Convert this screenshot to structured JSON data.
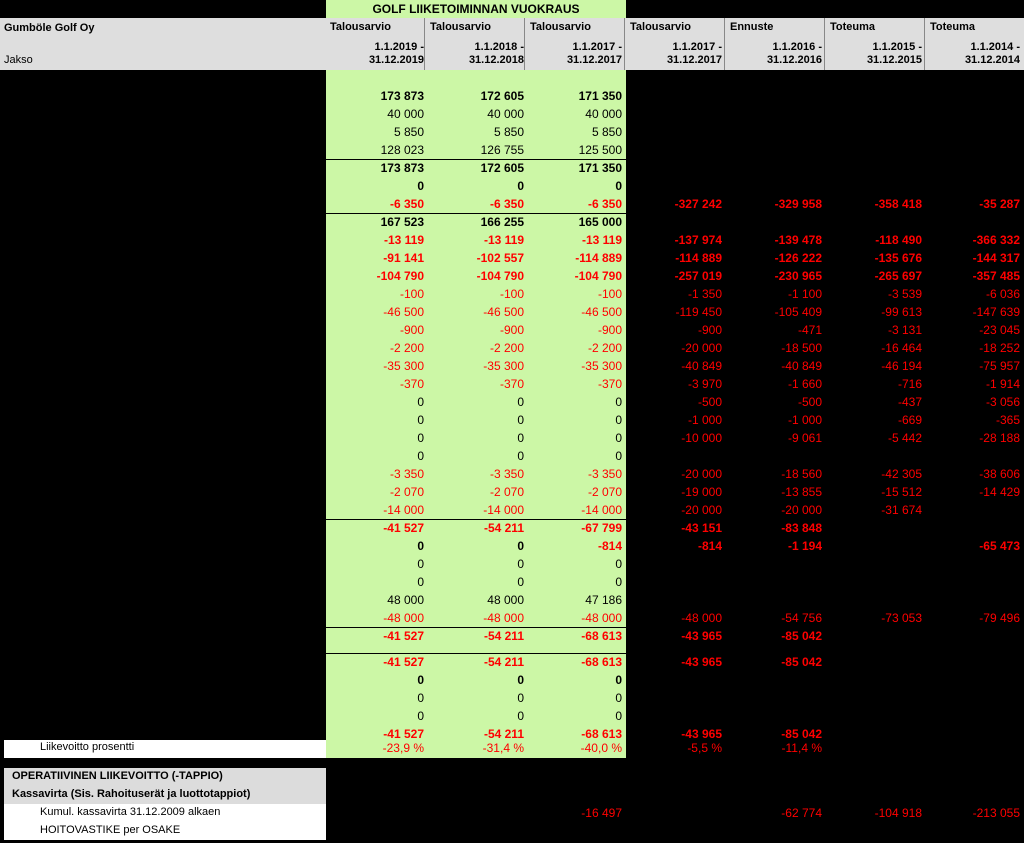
{
  "header": {
    "section_title": "GOLF LIIKETOIMINNAN VUOKRAUS",
    "company": "Gumböle Golf Oy",
    "period_label": "Jakso",
    "columns": [
      {
        "type": "Talousarvio",
        "p1": "1.1.2019 -",
        "p2": "31.12.2019"
      },
      {
        "type": "Talousarvio",
        "p1": "1.1.2018 -",
        "p2": "31.12.2018"
      },
      {
        "type": "Talousarvio",
        "p1": "1.1.2017 -",
        "p2": "31.12.2017"
      },
      {
        "type": "Talousarvio",
        "p1": "1.1.2017 -",
        "p2": "31.12.2017"
      },
      {
        "type": "Ennuste",
        "p1": "1.1.2016 -",
        "p2": "31.12.2016"
      },
      {
        "type": "Toteuma",
        "p1": "1.1.2015 -",
        "p2": "31.12.2015"
      },
      {
        "type": "Toteuma",
        "p1": "1.1.2014 -",
        "p2": "31.12.2014"
      }
    ]
  },
  "rows": [
    {
      "v": [
        "",
        "",
        "",
        "",
        "",
        "",
        ""
      ]
    },
    {
      "v": [
        "173 873",
        "172 605",
        "171 350",
        "",
        "",
        "",
        ""
      ],
      "bold": true
    },
    {
      "v": [
        "40 000",
        "40 000",
        "40 000",
        "",
        "",
        "",
        ""
      ]
    },
    {
      "v": [
        "5 850",
        "5 850",
        "5 850",
        "",
        "",
        "",
        ""
      ]
    },
    {
      "v": [
        "128 023",
        "126 755",
        "125 500",
        "",
        "",
        "",
        ""
      ]
    },
    {
      "v": [
        "173 873",
        "172 605",
        "171 350",
        "",
        "",
        "",
        ""
      ],
      "bold": true,
      "line": true
    },
    {
      "v": [
        "0",
        "0",
        "0",
        "",
        "",
        "",
        ""
      ],
      "bold": true
    },
    {
      "v": [
        "-6 350",
        "-6 350",
        "-6 350",
        "-327 242",
        "-329 958",
        "-358 418",
        "-35 287"
      ],
      "bold": true,
      "red": true
    },
    {
      "v": [
        "167 523",
        "166 255",
        "165 000",
        "",
        "",
        "",
        ""
      ],
      "bold": true,
      "line": true
    },
    {
      "v": [
        "-13 119",
        "-13 119",
        "-13 119",
        "-137 974",
        "-139 478",
        "-118 490",
        "-366 332"
      ],
      "bold": true,
      "red": true
    },
    {
      "v": [
        "-91 141",
        "-102 557",
        "-114 889",
        "-114 889",
        "-126 222",
        "-135 676",
        "-144 317"
      ],
      "bold": true,
      "red": true
    },
    {
      "v": [
        "-104 790",
        "-104 790",
        "-104 790",
        "-257 019",
        "-230 965",
        "-265 697",
        "-357 485"
      ],
      "bold": true,
      "red": true
    },
    {
      "v": [
        "-100",
        "-100",
        "-100",
        "-1 350",
        "-1 100",
        "-3 539",
        "-6 036"
      ],
      "red": true
    },
    {
      "v": [
        "-46 500",
        "-46 500",
        "-46 500",
        "-119 450",
        "-105 409",
        "-99 613",
        "-147 639"
      ],
      "red": true
    },
    {
      "v": [
        "-900",
        "-900",
        "-900",
        "-900",
        "-471",
        "-3 131",
        "-23 045"
      ],
      "red": true
    },
    {
      "v": [
        "-2 200",
        "-2 200",
        "-2 200",
        "-20 000",
        "-18 500",
        "-16 464",
        "-18 252"
      ],
      "red": true
    },
    {
      "v": [
        "-35 300",
        "-35 300",
        "-35 300",
        "-40 849",
        "-40 849",
        "-46 194",
        "-75 957"
      ],
      "red": true
    },
    {
      "v": [
        "-370",
        "-370",
        "-370",
        "-3 970",
        "-1 660",
        "-716",
        "-1 914"
      ],
      "red": true
    },
    {
      "v": [
        "0",
        "0",
        "0",
        "-500",
        "-500",
        "-437",
        "-3 056"
      ],
      "red": true
    },
    {
      "v": [
        "0",
        "0",
        "0",
        "-1 000",
        "-1 000",
        "-669",
        "-365"
      ],
      "red": true
    },
    {
      "v": [
        "0",
        "0",
        "0",
        "-10 000",
        "-9 061",
        "-5 442",
        "-28 188"
      ],
      "red": true
    },
    {
      "v": [
        "0",
        "0",
        "0",
        "",
        "",
        "",
        ""
      ],
      "red": true
    },
    {
      "v": [
        "-3 350",
        "-3 350",
        "-3 350",
        "-20 000",
        "-18 560",
        "-42 305",
        "-38 606"
      ],
      "red": true
    },
    {
      "v": [
        "-2 070",
        "-2 070",
        "-2 070",
        "-19 000",
        "-13 855",
        "-15 512",
        "-14 429"
      ],
      "red": true
    },
    {
      "v": [
        "-14 000",
        "-14 000",
        "-14 000",
        "-20 000",
        "-20 000",
        "-31 674",
        ""
      ],
      "red": true
    },
    {
      "v": [
        "-41 527",
        "-54 211",
        "-67 799",
        "-43 151",
        "-83 848",
        "",
        ""
      ],
      "bold": true,
      "red": true,
      "line": true
    },
    {
      "v": [
        "0",
        "0",
        "-814",
        "-814",
        "-1 194",
        "",
        "-65 473"
      ],
      "bold": true,
      "red": true,
      "mixed": true
    },
    {
      "v": [
        "0",
        "0",
        "0",
        "",
        "",
        "",
        ""
      ]
    },
    {
      "v": [
        "0",
        "0",
        "0",
        "",
        "",
        "",
        ""
      ]
    },
    {
      "v": [
        "48 000",
        "48 000",
        "47 186",
        "",
        "",
        "",
        ""
      ]
    },
    {
      "v": [
        "-48 000",
        "-48 000",
        "-48 000",
        "-48 000",
        "-54 756",
        "-73 053",
        "-79 496"
      ],
      "red": true
    },
    {
      "v": [
        "-41 527",
        "-54 211",
        "-68 613",
        "-43 965",
        "-85 042",
        "",
        ""
      ],
      "bold": true,
      "red": true,
      "line": true
    },
    {
      "v": [
        "-41 527",
        "-54 211",
        "-68 613",
        "-43 965",
        "-85 042",
        "",
        ""
      ],
      "bold": true,
      "red": true,
      "line": true,
      "gap": true
    },
    {
      "v": [
        "0",
        "0",
        "0",
        "",
        "",
        "",
        ""
      ],
      "bold": true
    },
    {
      "v": [
        "0",
        "0",
        "0",
        "",
        "",
        "",
        ""
      ]
    },
    {
      "v": [
        "0",
        "0",
        "0",
        "",
        "",
        "",
        ""
      ]
    },
    {
      "v": [
        "-41 527",
        "-54 211",
        "-68 613",
        "-43 965",
        "-85 042",
        "",
        ""
      ],
      "bold": true,
      "red": true
    }
  ],
  "footer": {
    "liikevoitto_label": "Liikevoitto prosentti",
    "liikevoitto_values": [
      "-23,9 %",
      "-31,4 %",
      "-40,0 %",
      "-5,5 %",
      "-11,4 %",
      "",
      ""
    ],
    "operatiivinen_label": "OPERATIIVINEN LIIKEVOITTO (-TAPPIO)",
    "kassavirta_label": "Kassavirta (Sis. Rahoituserät ja luottotappiot)",
    "kumul_label": "Kumul. kassavirta 31.12.2009 alkaen",
    "kumul_values": [
      "",
      "",
      "-16 497",
      "",
      "-62 774",
      "-104 918",
      "-213 055"
    ],
    "hoitovastike_label": "HOITOVASTIKE per OSAKE"
  }
}
